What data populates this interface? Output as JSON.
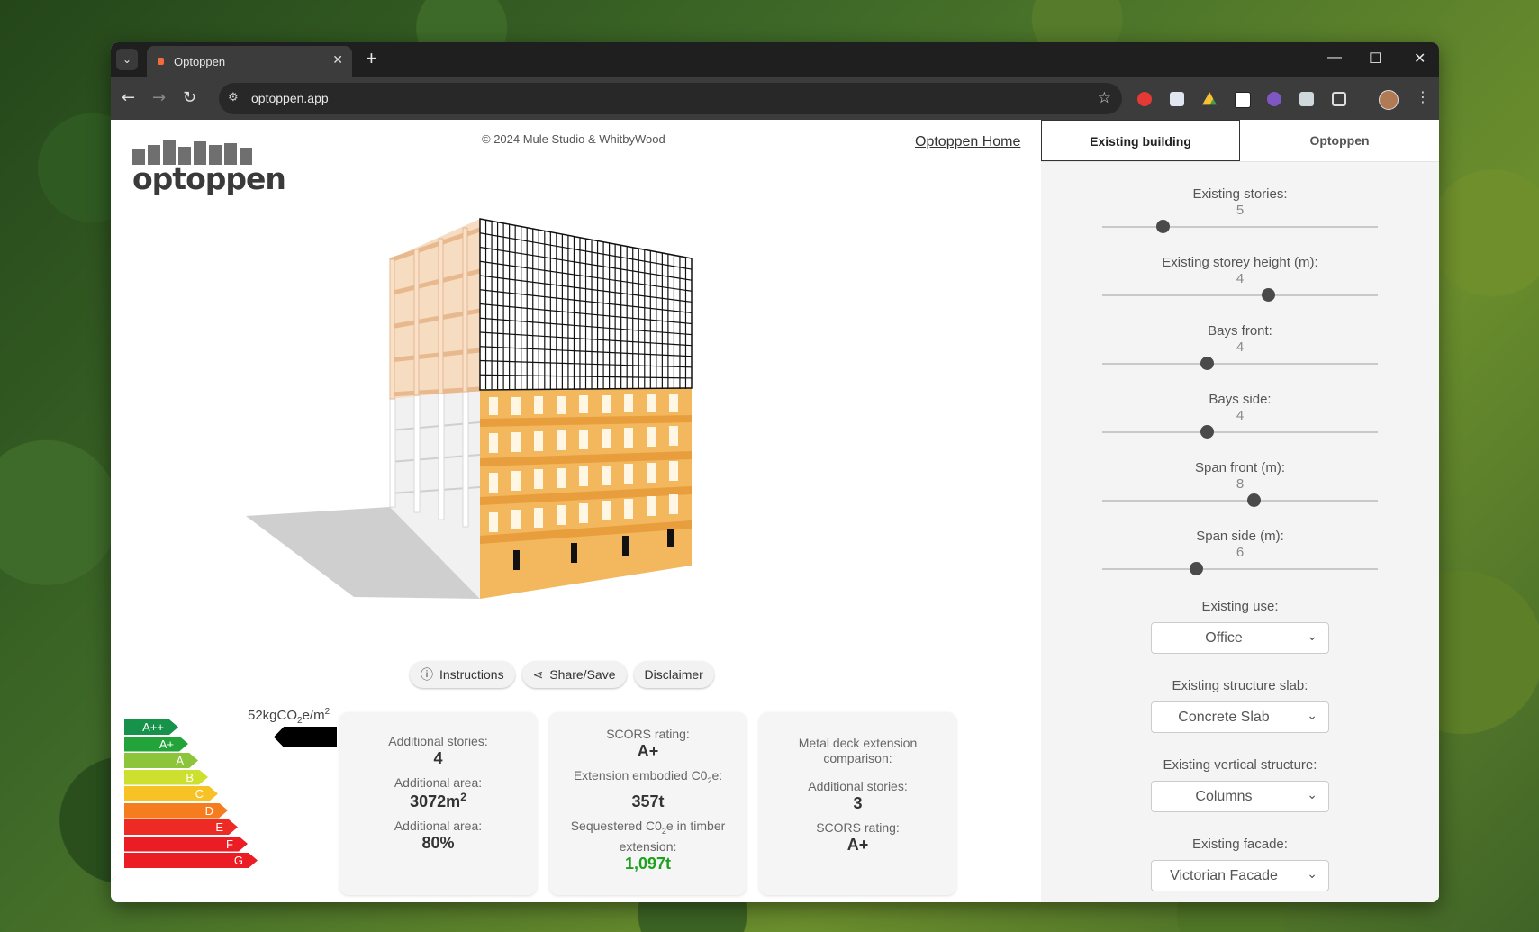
{
  "browser": {
    "tab_title": "Optoppen",
    "url": "optoppen.app",
    "new_tab": "+"
  },
  "page": {
    "logo_text": "optoppen",
    "copyright": "© 2024 Mule Studio & WhitbyWood",
    "home_link": "Optoppen Home"
  },
  "buttons": {
    "instructions": "Instructions",
    "share": "Share/Save",
    "disclaimer": "Disclaimer"
  },
  "energy": {
    "value_prefix": "52kgCO",
    "value_sub": "2",
    "value_mid": "e/m",
    "value_sup": "2",
    "ratings": [
      {
        "label": "A++",
        "color": "#16924a"
      },
      {
        "label": "A+",
        "color": "#23a43b"
      },
      {
        "label": "A",
        "color": "#8cc43a"
      },
      {
        "label": "B",
        "color": "#cde02f"
      },
      {
        "label": "C",
        "color": "#f6c224"
      },
      {
        "label": "D",
        "color": "#f57d1f"
      },
      {
        "label": "E",
        "color": "#ee2a24"
      },
      {
        "label": "F",
        "color": "#ec1c24"
      },
      {
        "label": "G",
        "color": "#ec1c24"
      }
    ],
    "selected_rating": "A+"
  },
  "stats": {
    "additional_stories_label": "Additional stories:",
    "additional_stories": "4",
    "additional_area_label": "Additional area:",
    "additional_area": "3072m",
    "additional_area_sup": "2",
    "additional_area_pct_label": "Additional area:",
    "additional_area_pct": "80%"
  },
  "scors": {
    "rating_label": "SCORS rating:",
    "rating": "A+",
    "embodied_label_a": "Extension embodied C0",
    "embodied_label_sub": "2",
    "embodied_label_b": "e:",
    "embodied": "357t",
    "sequestered_label_a": "Sequestered C0",
    "sequestered_label_sub": "2",
    "sequestered_label_b": "e in timber extension:",
    "sequestered": "1,097t"
  },
  "comparison": {
    "title": "Metal deck extension comparison:",
    "stories_label": "Additional stories:",
    "stories": "3",
    "rating_label": "SCORS rating:",
    "rating": "A+"
  },
  "panel": {
    "tabs": [
      "Existing building",
      "Optoppen"
    ],
    "sliders": [
      {
        "label": "Existing stories:",
        "value": "5",
        "fraction": 0.22
      },
      {
        "label": "Existing storey height (m):",
        "value": "4",
        "fraction": 0.6
      },
      {
        "label": "Bays front:",
        "value": "4",
        "fraction": 0.38
      },
      {
        "label": "Bays side:",
        "value": "4",
        "fraction": 0.38
      },
      {
        "label": "Span front (m):",
        "value": "8",
        "fraction": 0.55
      },
      {
        "label": "Span side (m):",
        "value": "6",
        "fraction": 0.34
      }
    ],
    "selects": [
      {
        "label": "Existing use:",
        "value": "Office"
      },
      {
        "label": "Existing structure slab:",
        "value": "Concrete Slab"
      },
      {
        "label": "Existing vertical structure:",
        "value": "Columns"
      },
      {
        "label": "Existing facade:",
        "value": "Victorian Facade"
      }
    ]
  }
}
